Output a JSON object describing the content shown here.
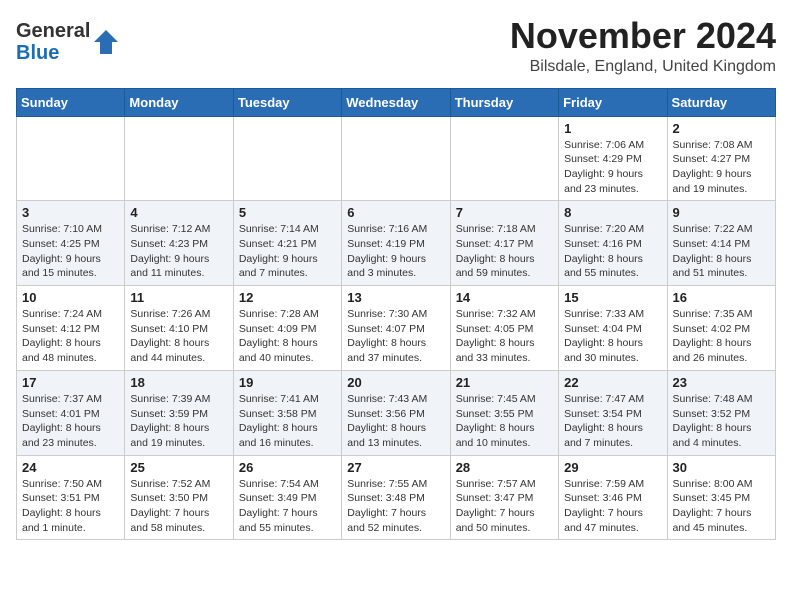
{
  "header": {
    "logo_line1": "General",
    "logo_line2": "Blue",
    "month": "November 2024",
    "location": "Bilsdale, England, United Kingdom"
  },
  "weekdays": [
    "Sunday",
    "Monday",
    "Tuesday",
    "Wednesday",
    "Thursday",
    "Friday",
    "Saturday"
  ],
  "weeks": [
    [
      {
        "day": "",
        "info": ""
      },
      {
        "day": "",
        "info": ""
      },
      {
        "day": "",
        "info": ""
      },
      {
        "day": "",
        "info": ""
      },
      {
        "day": "",
        "info": ""
      },
      {
        "day": "1",
        "info": "Sunrise: 7:06 AM\nSunset: 4:29 PM\nDaylight: 9 hours and 23 minutes."
      },
      {
        "day": "2",
        "info": "Sunrise: 7:08 AM\nSunset: 4:27 PM\nDaylight: 9 hours and 19 minutes."
      }
    ],
    [
      {
        "day": "3",
        "info": "Sunrise: 7:10 AM\nSunset: 4:25 PM\nDaylight: 9 hours and 15 minutes."
      },
      {
        "day": "4",
        "info": "Sunrise: 7:12 AM\nSunset: 4:23 PM\nDaylight: 9 hours and 11 minutes."
      },
      {
        "day": "5",
        "info": "Sunrise: 7:14 AM\nSunset: 4:21 PM\nDaylight: 9 hours and 7 minutes."
      },
      {
        "day": "6",
        "info": "Sunrise: 7:16 AM\nSunset: 4:19 PM\nDaylight: 9 hours and 3 minutes."
      },
      {
        "day": "7",
        "info": "Sunrise: 7:18 AM\nSunset: 4:17 PM\nDaylight: 8 hours and 59 minutes."
      },
      {
        "day": "8",
        "info": "Sunrise: 7:20 AM\nSunset: 4:16 PM\nDaylight: 8 hours and 55 minutes."
      },
      {
        "day": "9",
        "info": "Sunrise: 7:22 AM\nSunset: 4:14 PM\nDaylight: 8 hours and 51 minutes."
      }
    ],
    [
      {
        "day": "10",
        "info": "Sunrise: 7:24 AM\nSunset: 4:12 PM\nDaylight: 8 hours and 48 minutes."
      },
      {
        "day": "11",
        "info": "Sunrise: 7:26 AM\nSunset: 4:10 PM\nDaylight: 8 hours and 44 minutes."
      },
      {
        "day": "12",
        "info": "Sunrise: 7:28 AM\nSunset: 4:09 PM\nDaylight: 8 hours and 40 minutes."
      },
      {
        "day": "13",
        "info": "Sunrise: 7:30 AM\nSunset: 4:07 PM\nDaylight: 8 hours and 37 minutes."
      },
      {
        "day": "14",
        "info": "Sunrise: 7:32 AM\nSunset: 4:05 PM\nDaylight: 8 hours and 33 minutes."
      },
      {
        "day": "15",
        "info": "Sunrise: 7:33 AM\nSunset: 4:04 PM\nDaylight: 8 hours and 30 minutes."
      },
      {
        "day": "16",
        "info": "Sunrise: 7:35 AM\nSunset: 4:02 PM\nDaylight: 8 hours and 26 minutes."
      }
    ],
    [
      {
        "day": "17",
        "info": "Sunrise: 7:37 AM\nSunset: 4:01 PM\nDaylight: 8 hours and 23 minutes."
      },
      {
        "day": "18",
        "info": "Sunrise: 7:39 AM\nSunset: 3:59 PM\nDaylight: 8 hours and 19 minutes."
      },
      {
        "day": "19",
        "info": "Sunrise: 7:41 AM\nSunset: 3:58 PM\nDaylight: 8 hours and 16 minutes."
      },
      {
        "day": "20",
        "info": "Sunrise: 7:43 AM\nSunset: 3:56 PM\nDaylight: 8 hours and 13 minutes."
      },
      {
        "day": "21",
        "info": "Sunrise: 7:45 AM\nSunset: 3:55 PM\nDaylight: 8 hours and 10 minutes."
      },
      {
        "day": "22",
        "info": "Sunrise: 7:47 AM\nSunset: 3:54 PM\nDaylight: 8 hours and 7 minutes."
      },
      {
        "day": "23",
        "info": "Sunrise: 7:48 AM\nSunset: 3:52 PM\nDaylight: 8 hours and 4 minutes."
      }
    ],
    [
      {
        "day": "24",
        "info": "Sunrise: 7:50 AM\nSunset: 3:51 PM\nDaylight: 8 hours and 1 minute."
      },
      {
        "day": "25",
        "info": "Sunrise: 7:52 AM\nSunset: 3:50 PM\nDaylight: 7 hours and 58 minutes."
      },
      {
        "day": "26",
        "info": "Sunrise: 7:54 AM\nSunset: 3:49 PM\nDaylight: 7 hours and 55 minutes."
      },
      {
        "day": "27",
        "info": "Sunrise: 7:55 AM\nSunset: 3:48 PM\nDaylight: 7 hours and 52 minutes."
      },
      {
        "day": "28",
        "info": "Sunrise: 7:57 AM\nSunset: 3:47 PM\nDaylight: 7 hours and 50 minutes."
      },
      {
        "day": "29",
        "info": "Sunrise: 7:59 AM\nSunset: 3:46 PM\nDaylight: 7 hours and 47 minutes."
      },
      {
        "day": "30",
        "info": "Sunrise: 8:00 AM\nSunset: 3:45 PM\nDaylight: 7 hours and 45 minutes."
      }
    ]
  ]
}
